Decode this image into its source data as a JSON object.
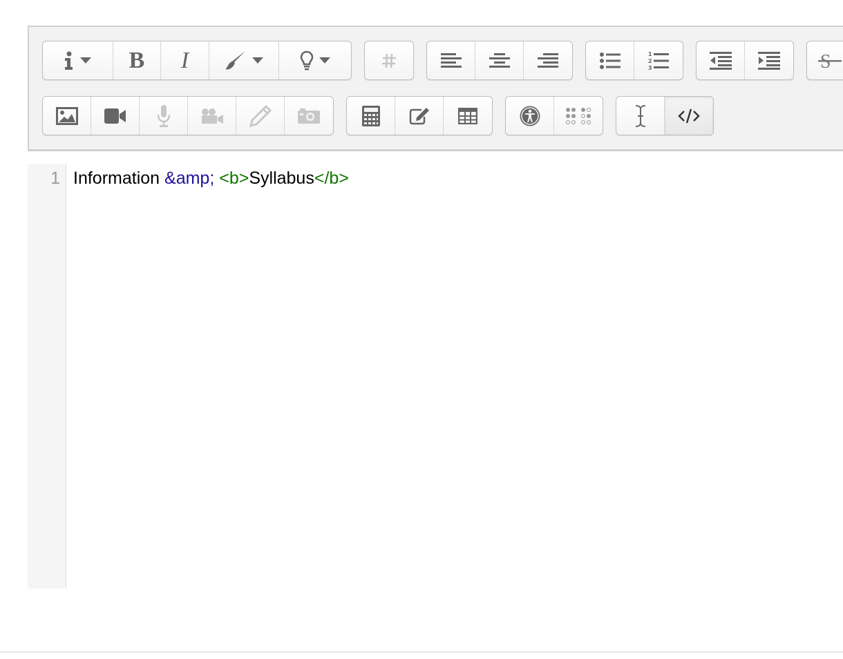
{
  "toolbar": {
    "row1": [
      {
        "group": "text-style",
        "buttons": [
          {
            "icon": "info-icon",
            "dropdown": true
          },
          {
            "icon": "bold-icon",
            "glyph": "B"
          },
          {
            "icon": "italic-icon",
            "glyph": "I"
          },
          {
            "icon": "brush-icon",
            "dropdown": true
          },
          {
            "icon": "lightbulb-icon",
            "dropdown": true
          }
        ]
      },
      {
        "group": "hashtag",
        "buttons": [
          {
            "icon": "hashtag-icon"
          }
        ]
      },
      {
        "group": "alignment",
        "buttons": [
          {
            "icon": "align-left-icon"
          },
          {
            "icon": "align-center-icon"
          },
          {
            "icon": "align-right-icon"
          }
        ]
      },
      {
        "group": "lists",
        "buttons": [
          {
            "icon": "unordered-list-icon"
          },
          {
            "icon": "ordered-list-icon"
          }
        ]
      },
      {
        "group": "indent",
        "buttons": [
          {
            "icon": "outdent-icon"
          },
          {
            "icon": "indent-icon"
          }
        ]
      },
      {
        "group": "strikethrough",
        "buttons": [
          {
            "icon": "strikethrough-icon"
          }
        ]
      }
    ],
    "row2": [
      {
        "group": "media",
        "buttons": [
          {
            "icon": "image-icon"
          },
          {
            "icon": "video-icon"
          },
          {
            "icon": "microphone-icon",
            "disabled": true
          },
          {
            "icon": "video-camera-icon",
            "disabled": true
          },
          {
            "icon": "pencil-icon",
            "disabled": true
          },
          {
            "icon": "camera-icon",
            "disabled": true
          }
        ]
      },
      {
        "group": "insert",
        "buttons": [
          {
            "icon": "calculator-icon"
          },
          {
            "icon": "edit-icon"
          },
          {
            "icon": "table-icon"
          }
        ]
      },
      {
        "group": "accessibility",
        "buttons": [
          {
            "icon": "accessibility-icon"
          },
          {
            "icon": "braille-icon"
          }
        ]
      },
      {
        "group": "source",
        "buttons": [
          {
            "icon": "text-cursor-icon"
          },
          {
            "icon": "code-icon",
            "active": true
          }
        ]
      }
    ]
  },
  "code": {
    "line_number": "1",
    "text_before": "Information ",
    "entity": "&amp;",
    "space": " ",
    "open_tag": "<b>",
    "content": "Syllabus",
    "close_tag": "</b>"
  },
  "colors": {
    "entity": "#221199",
    "tag": "#117700",
    "icon": "#666666",
    "icon_disabled": "#c8c8c8"
  }
}
